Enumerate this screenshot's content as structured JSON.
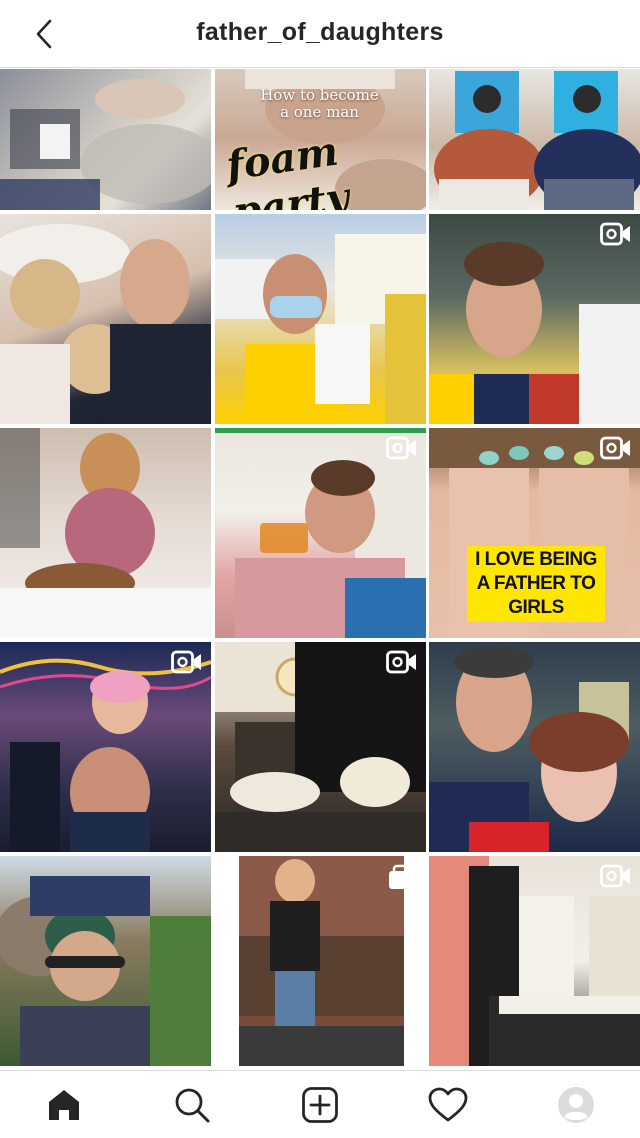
{
  "header": {
    "username": "father_of_daughters",
    "back_icon": "chevron-left-icon"
  },
  "grid": {
    "tiles": [
      {
        "type": "photo",
        "description_icon": "photo",
        "video": false
      },
      {
        "type": "photo",
        "video": false,
        "caption": "How to become a one man",
        "highlight": "foam party"
      },
      {
        "type": "photo",
        "video": false
      },
      {
        "type": "photo",
        "video": false
      },
      {
        "type": "photo",
        "video": false
      },
      {
        "type": "video",
        "video": true
      },
      {
        "type": "photo",
        "video": false
      },
      {
        "type": "video",
        "video": true
      },
      {
        "type": "video",
        "video": true,
        "sticker": "I LOVE BEING A FATHER TO GIRLS"
      },
      {
        "type": "video",
        "video": true
      },
      {
        "type": "video",
        "video": true
      },
      {
        "type": "photo",
        "video": false
      },
      {
        "type": "photo",
        "video": false
      },
      {
        "type": "carousel",
        "video": false
      },
      {
        "type": "video",
        "video": true
      }
    ]
  },
  "nav": {
    "items": [
      "home-icon",
      "search-icon",
      "new-post-icon",
      "activity-heart-icon",
      "profile-avatar-icon"
    ],
    "active": "home-icon"
  },
  "colors": {
    "text": "#262626",
    "divider": "#dbdbdb",
    "sticker": "#ffe600"
  }
}
